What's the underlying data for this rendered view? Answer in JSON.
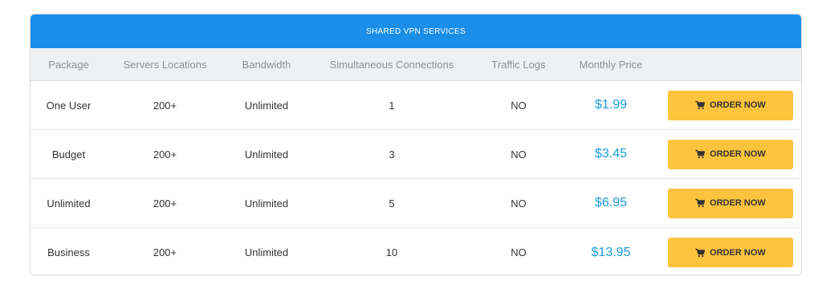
{
  "table": {
    "title": "SHARED VPN SERVICES",
    "headers": [
      "Package",
      "Servers Locations",
      "Bandwidth",
      "Simultaneous Connections",
      "Traffic Logs",
      "Monthly Price",
      ""
    ],
    "rows": [
      {
        "package": "One User",
        "locations": "200+",
        "bandwidth": "Unlimited",
        "connections": "1",
        "logs": "NO",
        "price": "$1.99",
        "button": "ORDER NOW"
      },
      {
        "package": "Budget",
        "locations": "200+",
        "bandwidth": "Unlimited",
        "connections": "3",
        "logs": "NO",
        "price": "$3.45",
        "button": "ORDER NOW"
      },
      {
        "package": "Unlimited",
        "locations": "200+",
        "bandwidth": "Unlimited",
        "connections": "5",
        "logs": "NO",
        "price": "$6.95",
        "button": "ORDER NOW"
      },
      {
        "package": "Business",
        "locations": "200+",
        "bandwidth": "Unlimited",
        "connections": "10",
        "logs": "NO",
        "price": "$13.95",
        "button": "ORDER NOW"
      }
    ]
  },
  "colors": {
    "title_bar": "#1a8ee8",
    "price": "#1a9ce0",
    "button": "#fcc33c"
  },
  "icons": {
    "order_button": "cart-icon"
  }
}
